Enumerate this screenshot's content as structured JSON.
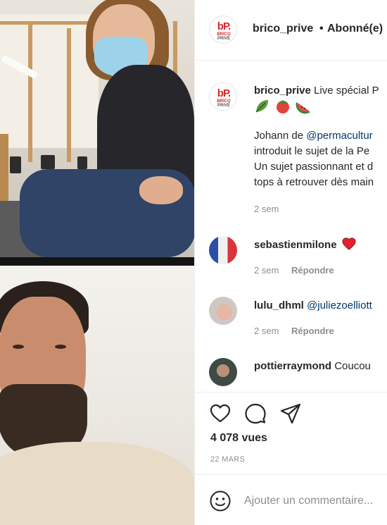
{
  "header": {
    "username": "brico_prive",
    "separator": "•",
    "follow_status": "Abonné(e)",
    "logo": {
      "mark": "bP.",
      "line1": "BRICO",
      "line2": "PRIVÉ"
    }
  },
  "caption": {
    "username": "brico_prive",
    "text": "Live spécial P",
    "emojis": [
      "leaf-emoji",
      "tomato-emoji",
      "watermelon-emoji"
    ],
    "body_line1_prefix": "Johann de ",
    "body_line1_mention": "@permacultur",
    "body_line2": "introduit le sujet de la Pe",
    "body_line3": "Un sujet passionnant et d",
    "body_line4": "tops à retrouver dès main",
    "time": "2 sem"
  },
  "comments": [
    {
      "username": "sebastienmilone",
      "text": "",
      "mention": "",
      "has_heart": true,
      "time": "2 sem",
      "reply_label": "Répondre",
      "avatar": "flag-avatar"
    },
    {
      "username": "lulu_dhml",
      "text": "",
      "mention": "@juliezoelliott",
      "has_heart": false,
      "time": "2 sem",
      "reply_label": "Répondre",
      "avatar": "baby-avatar"
    },
    {
      "username": "pottierraymond",
      "text": "Coucou",
      "mention": "",
      "has_heart": false,
      "time": "",
      "reply_label": "",
      "avatar": "man-avatar"
    }
  ],
  "actions": {
    "icons": [
      "heart-icon",
      "comment-icon",
      "share-icon"
    ],
    "views": "4 078 vues",
    "date": "22 MARS"
  },
  "add_comment": {
    "placeholder": "Ajouter un commentaire...",
    "icon": "smiley-icon"
  },
  "colors": {
    "text": "#262626",
    "muted": "#8e8e8e",
    "mention": "#00376b",
    "border": "#efefef",
    "brand_red": "#d7262a",
    "heart": "#ed4956"
  }
}
